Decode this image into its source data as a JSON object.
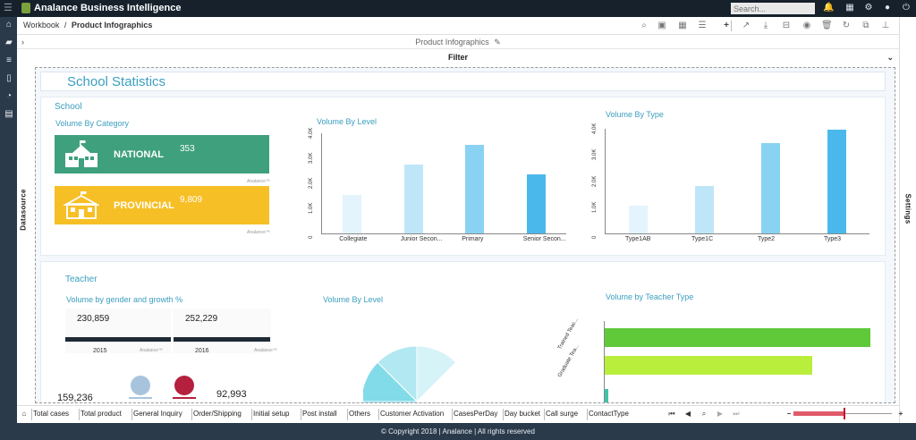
{
  "app": {
    "title": "Analance Business Intelligence",
    "search_placeholder": "Search..."
  },
  "breadcrumb": {
    "root": "Workbook",
    "sep": "/",
    "current": "Product Infographics"
  },
  "subtitle": "Product Infographics",
  "filter_label": "Filter",
  "side_labels": {
    "left": "Datasource",
    "right": "Settings"
  },
  "dashboard": {
    "title": "School Statistics"
  },
  "school": {
    "section": "School",
    "category_title": "Volume By Category",
    "national": {
      "label": "NATIONAL",
      "value": "353"
    },
    "provincial": {
      "label": "PROVINCIAL",
      "value": "9,809"
    },
    "watermark": "Analance™"
  },
  "chart_data": [
    {
      "type": "bar",
      "title": "Volume By Level",
      "categories": [
        "Collegiate",
        "Junior Secon...",
        "Primary",
        "Senior Secon..."
      ],
      "values": [
        1550,
        2750,
        3550,
        2350
      ],
      "yticks": [
        "0",
        "1.0K",
        "2.0K",
        "3.0K",
        "4.0K"
      ],
      "ylim": [
        0,
        4000
      ],
      "colors": [
        "#e4f4fc",
        "#bfe6f8",
        "#8ad2f2",
        "#4bb8ec"
      ]
    },
    {
      "type": "bar",
      "title": "Volume By Type",
      "categories": [
        "Type1AB",
        "Type1C",
        "Type2",
        "Type3"
      ],
      "values": [
        1050,
        1800,
        3450,
        3950
      ],
      "yticks": [
        "0",
        "1.0K",
        "2.0K",
        "3.0K",
        "4.0K"
      ],
      "ylim": [
        0,
        4000
      ],
      "colors": [
        "#e4f4fc",
        "#bfe6f8",
        "#8ad2f2",
        "#4bb8ec"
      ]
    },
    {
      "type": "pie",
      "title": "Volume By Level",
      "colors": [
        "#4cc9dc",
        "#82dbe8",
        "#b2e8f1",
        "#d6f3f8"
      ]
    },
    {
      "type": "bar",
      "title": "Volume by Teacher Type",
      "categories": [
        "Trained Teac...",
        "Graduate Tea...",
        ""
      ],
      "values": [
        100,
        78,
        1
      ],
      "colors": [
        "#5fc93a",
        "#b9ef3c",
        "#3fc4a8"
      ]
    }
  ],
  "teacher": {
    "section": "Teacher",
    "gender_title": "Volume by gender and growth %",
    "cards": [
      {
        "value": "230,859",
        "year": "2015",
        "watermark": "Analance™"
      },
      {
        "value": "252,229",
        "year": "2016",
        "watermark": "Analance™"
      }
    ],
    "left_value": "159,236",
    "right_value": "92,993"
  },
  "bottom_tabs": [
    "Total cases",
    "Total product",
    "General Inquiry",
    "Order/Shipping",
    "Initial setup",
    "Post install",
    "Others",
    "Customer Activation",
    "CasesPerDay",
    "Day bucket",
    "Call surge",
    "ContactType"
  ],
  "footer": "© Copyright 2018 | Analance | All rights reserved"
}
